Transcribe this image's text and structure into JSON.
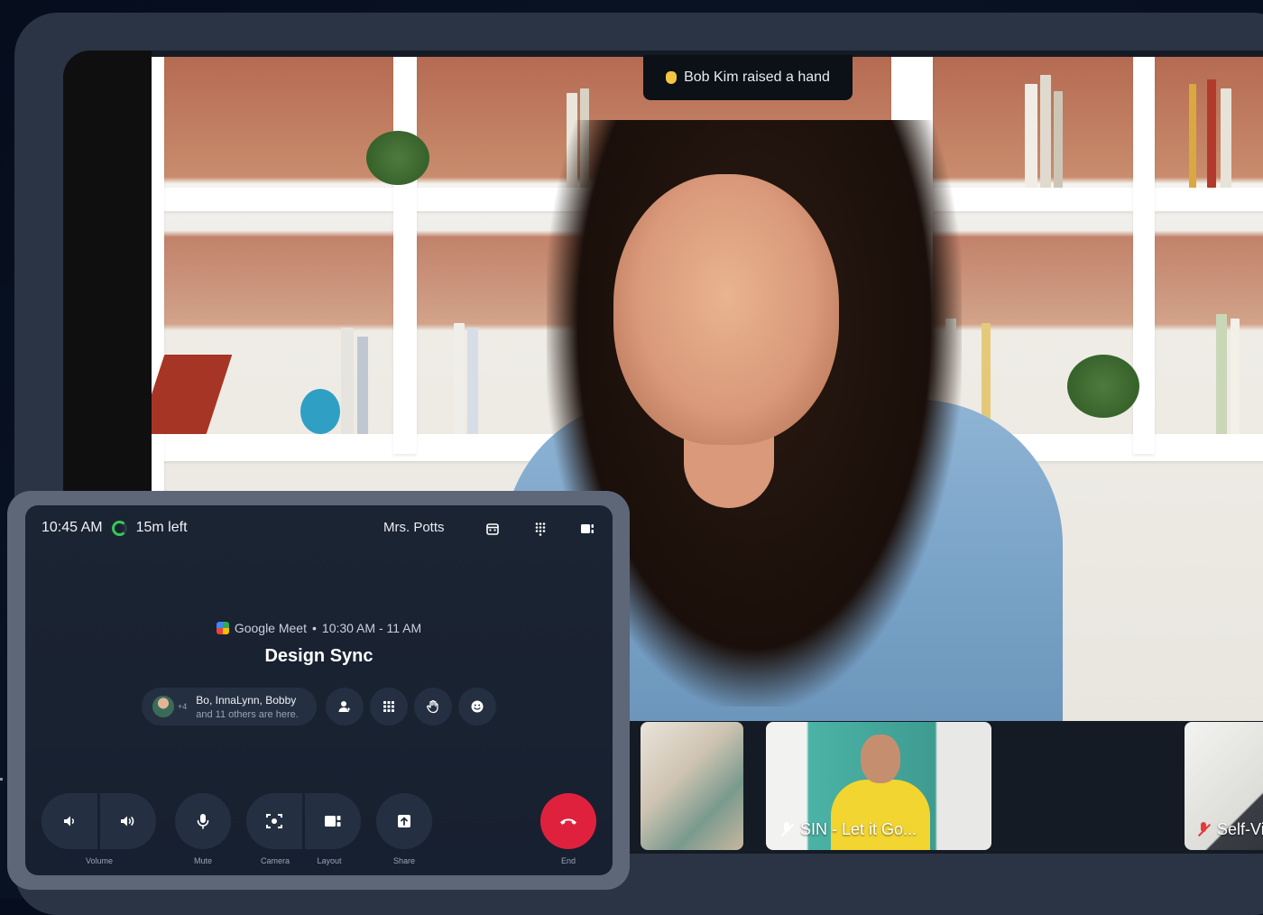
{
  "notification": {
    "text": "Bob Kim raised a hand"
  },
  "thumbnails": [
    {
      "label": ""
    },
    {
      "label": "SIN - Let it Go..."
    },
    {
      "label": "Self-Vie"
    }
  ],
  "status": {
    "time": "10:45 AM",
    "remaining": "15m left"
  },
  "room": {
    "name": "Mrs. Potts"
  },
  "meeting": {
    "provider": "Google Meet",
    "time_range": "10:30 AM - 11 AM",
    "title": "Design Sync"
  },
  "participants": {
    "extra_count": "+4",
    "names": "Bo, InnaLynn, Bobby",
    "others": "and 11 others are here."
  },
  "controls": {
    "volume": "Volume",
    "mute": "Mute",
    "camera": "Camera",
    "layout": "Layout",
    "share": "Share",
    "end": "End"
  },
  "colors": {
    "end_button": "#e0213e",
    "progress_ring": "#38c75a",
    "panel_bg": "#1b2432"
  },
  "icons": {
    "calendar": "calendar-icon",
    "dialpad": "dialpad-icon",
    "layout": "layout-icon",
    "add_person": "add-person-icon",
    "grid": "grid-icon",
    "raise_hand": "raise-hand-icon",
    "emoji": "emoji-icon",
    "volume_down": "volume-down-icon",
    "volume_up": "volume-up-icon",
    "mic": "mic-icon",
    "camera": "camera-frame-icon",
    "share": "share-icon",
    "end_call": "end-call-icon"
  }
}
